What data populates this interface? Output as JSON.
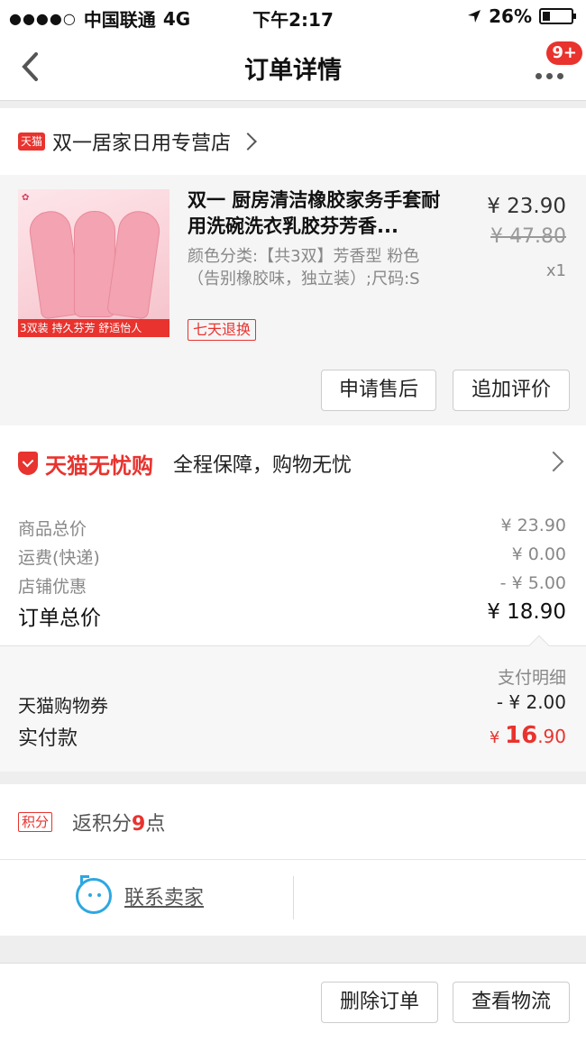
{
  "status_bar": {
    "carrier": "中国联通",
    "network": "4G",
    "time": "下午2:17",
    "battery": "26%",
    "battery_level": 0.26
  },
  "nav": {
    "title": "订单详情",
    "badge": "9+"
  },
  "store": {
    "tag": "天猫",
    "name": "双一居家日用专营店"
  },
  "product": {
    "title": "双一 厨房清洁橡胶家务手套耐用洗碗洗衣乳胶芬芳香...",
    "spec": "颜色分类:【共3双】芳香型 粉色（告别橡胶味，独立装）;尺码:S",
    "return_tag": "七天退换",
    "price": "¥ 23.90",
    "original_price": "¥ 47.80",
    "quantity": "x1",
    "thumb_strip": "3双装  持久芬芳  舒适怡人",
    "buttons": {
      "after_sale": "申请售后",
      "add_review": "追加评价"
    }
  },
  "guarantee": {
    "brand": "天猫无忧购",
    "text": "全程保障，购物无忧"
  },
  "summary": {
    "rows": [
      {
        "label": "商品总价",
        "value": "¥ 23.90"
      },
      {
        "label": "运费(快递)",
        "value": "¥ 0.00"
      },
      {
        "label": "店铺优惠",
        "value": "- ¥ 5.00"
      }
    ],
    "total_label": "订单总价",
    "total_value": "¥ 18.90"
  },
  "payment": {
    "detail_link": "支付明细",
    "coupon_label": "天猫购物券",
    "coupon_value": "- ¥ 2.00",
    "paid_label": "实付款",
    "paid_currency": "¥ ",
    "paid_int": "16",
    "paid_dec": ".90"
  },
  "points": {
    "tag": "积分",
    "prefix": "返积分",
    "num": "9",
    "suffix": "点"
  },
  "contact": {
    "label": "联系卖家"
  },
  "bottom_actions": {
    "delete_order": "删除订单",
    "view_logistics": "查看物流"
  }
}
